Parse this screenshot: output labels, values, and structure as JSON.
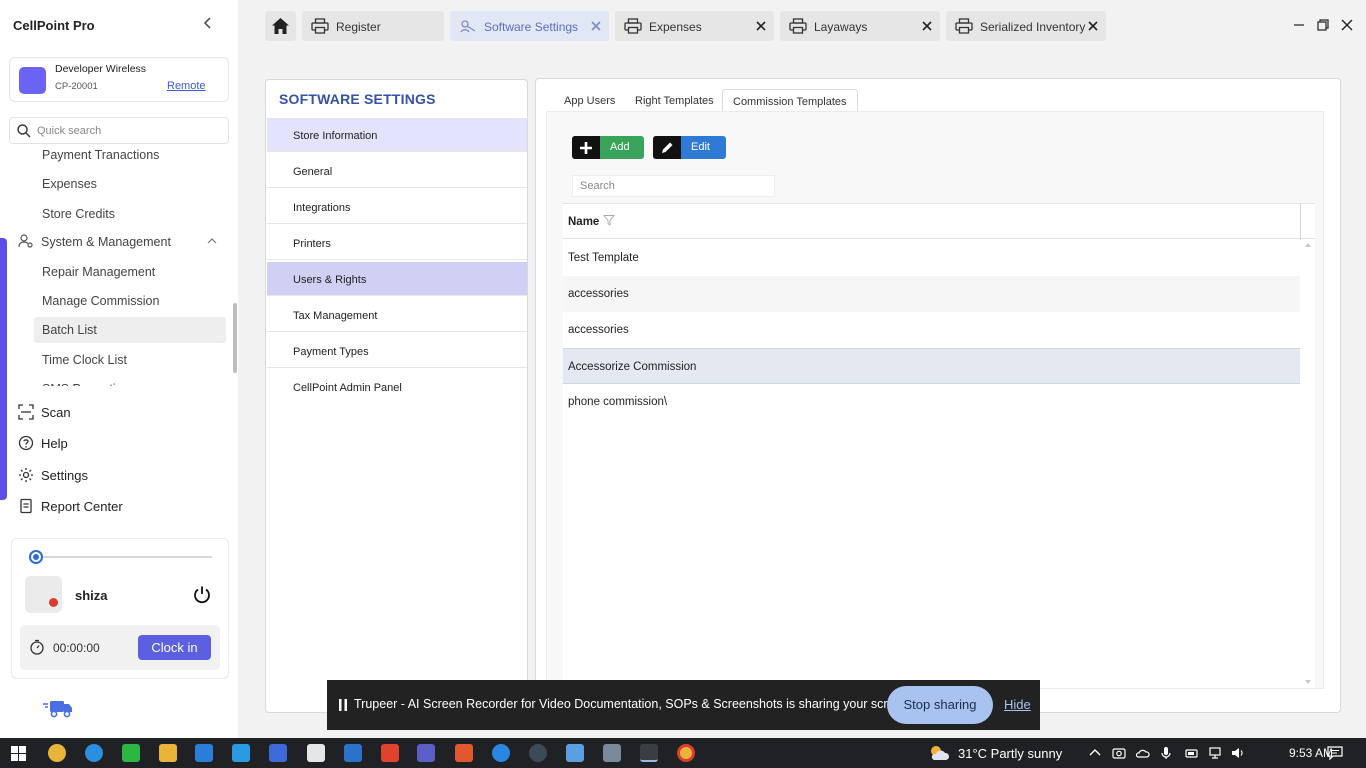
{
  "app": {
    "title": "CellPoint Pro"
  },
  "store": {
    "name": "Developer Wireless",
    "id": "CP-20001",
    "remote_label": "Remote"
  },
  "sidebar": {
    "search_placeholder": "Quick search",
    "items": {
      "payment_transactions": "Payment Tranactions",
      "expenses": "Expenses",
      "store_credits": "Store Credits",
      "system_management": "System & Management",
      "repair_management": "Repair Management",
      "manage_commission": "Manage Commission",
      "batch_list": "Batch List",
      "time_clock_list": "Time Clock List",
      "sms_partial": "SMS Promotion"
    },
    "main_items": {
      "scan": "Scan",
      "help": "Help",
      "settings": "Settings",
      "report_center": "Report Center"
    }
  },
  "user": {
    "name": "shiza",
    "timer": "00:00:00",
    "clock_in_label": "Clock in",
    "slider_level": 0
  },
  "tabs": [
    {
      "label": "Register",
      "icon": "printer-icon"
    },
    {
      "label": "Software Settings",
      "icon": "settings-tool-icon",
      "active": true
    },
    {
      "label": "Expenses",
      "icon": "printer-icon"
    },
    {
      "label": "Layaways",
      "icon": "printer-icon"
    },
    {
      "label": "Serialized Inventory",
      "icon": "printer-icon"
    }
  ],
  "settings_nav": {
    "title": "SOFTWARE SETTINGS",
    "items": [
      "Store Information",
      "General",
      "Integrations",
      "Printers",
      "Users & Rights",
      "Tax Management",
      "Payment Types",
      "CellPoint Admin Panel"
    ],
    "selected": "Store Information",
    "hovered": "Users & Rights"
  },
  "content": {
    "subtabs": [
      "App Users",
      "Right Templates",
      "Commission Templates"
    ],
    "active_subtab": "Commission Templates",
    "add_label": "Add",
    "edit_label": "Edit",
    "search_placeholder": "Search",
    "column_name": "Name",
    "rows": [
      "Test Template",
      "accessories",
      "accessories",
      "Accessorize Commission",
      "phone commission\\"
    ],
    "selected_row": "Accessorize Commission"
  },
  "share_bar": {
    "text": "Trupeer - AI Screen Recorder for Video Documentation, SOPs & Screenshots is sharing your screen.",
    "stop_label": "Stop sharing",
    "hide_label": "Hide"
  },
  "taskbar": {
    "weather": "31°C  Partly sunny",
    "time": "9:53 AM"
  },
  "colors": {
    "accent": "#5b4ee6",
    "title_blue": "#3652a8",
    "add_green": "#39a35a",
    "edit_blue": "#2f7ad6",
    "clock_in": "#5b5fe0",
    "selected_nav": "#e3e4fb"
  }
}
